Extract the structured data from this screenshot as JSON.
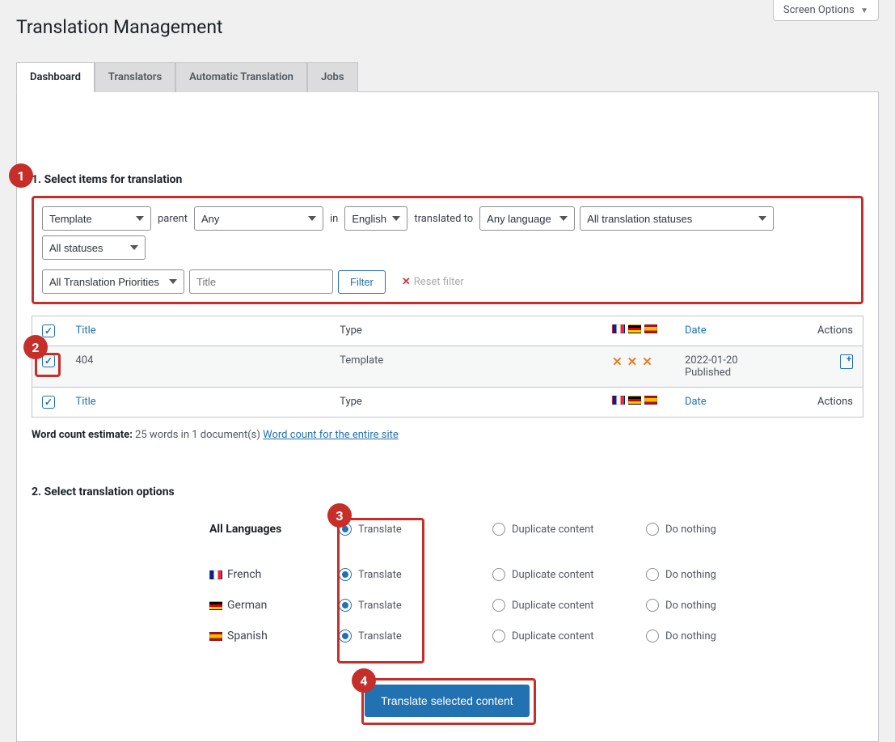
{
  "screen_options": "Screen Options",
  "page_title": "Translation Management",
  "tabs": [
    "Dashboard",
    "Translators",
    "Automatic Translation",
    "Jobs"
  ],
  "step1": {
    "title": "1. Select items for translation",
    "filters": {
      "post_type": "Template",
      "parent_label": "parent",
      "parent": "Any",
      "in_label": "in",
      "in_lang": "English",
      "translated_to_label": "translated to",
      "to_lang": "Any language",
      "status": "All translation statuses",
      "pub_status": "All statuses",
      "priority": "All Translation Priorities",
      "title_placeholder": "Title",
      "filter_btn": "Filter",
      "reset": "Reset filter"
    },
    "table": {
      "headers": {
        "title": "Title",
        "type": "Type",
        "date": "Date",
        "actions": "Actions"
      },
      "row": {
        "title": "404",
        "type": "Template",
        "date": "2022-01-20",
        "status": "Published"
      }
    },
    "word_count": {
      "label": "Word count estimate:",
      "text": "25 words in 1 document(s)",
      "link": "Word count for the entire site"
    }
  },
  "step2": {
    "title": "2. Select translation options",
    "all_label": "All Languages",
    "langs": [
      "French",
      "German",
      "Spanish"
    ],
    "options": {
      "translate": "Translate",
      "duplicate": "Duplicate content",
      "nothing": "Do nothing"
    },
    "submit": "Translate selected content"
  },
  "markers": {
    "m1": "1",
    "m2": "2",
    "m3": "3",
    "m4": "4"
  }
}
